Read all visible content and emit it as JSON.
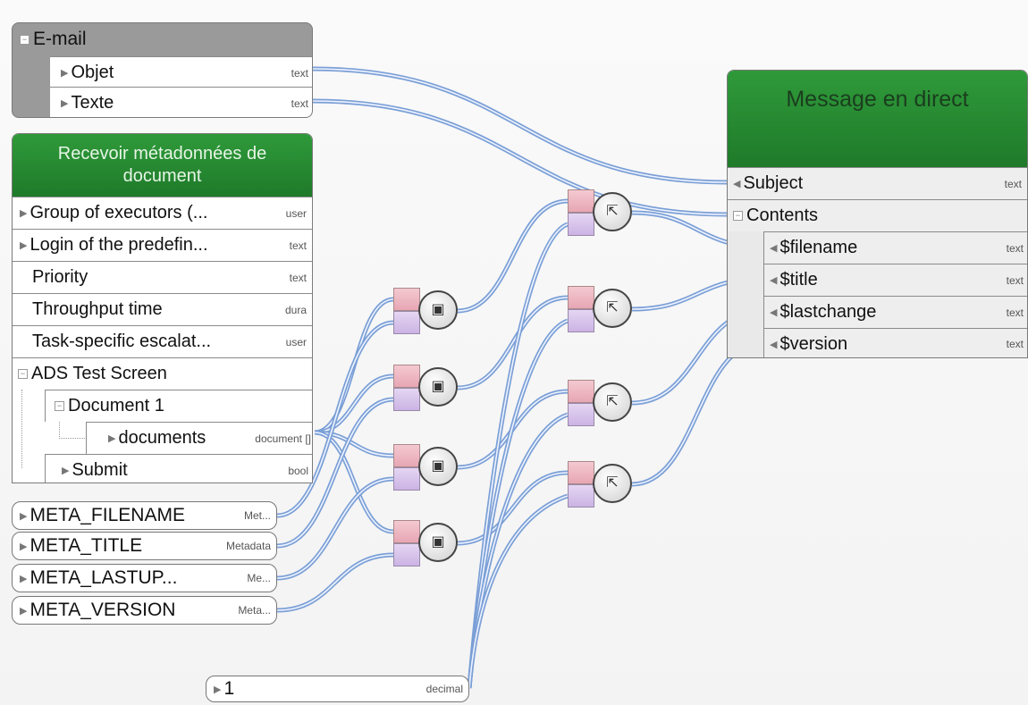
{
  "email_block": {
    "title": "E-mail",
    "rows": [
      {
        "label": "Objet",
        "type": "text"
      },
      {
        "label": "Texte",
        "type": "text"
      }
    ]
  },
  "metadata_block": {
    "title": "Recevoir métadonnées de document",
    "rows": [
      {
        "label": "Group of executors (...",
        "type": "user"
      },
      {
        "label": "Login of the predefin...",
        "type": "text"
      },
      {
        "label": "Priority",
        "type": "text"
      },
      {
        "label": "Throughput time",
        "type": "dura"
      },
      {
        "label": "Task-specific escalat...",
        "type": "user"
      },
      {
        "label": "ADS Test Screen",
        "type": ""
      },
      {
        "label": "Document 1",
        "type": ""
      },
      {
        "label": "documents",
        "type": "document []"
      },
      {
        "label": "Submit",
        "type": "bool"
      }
    ]
  },
  "constants": [
    {
      "label": "META_FILENAME",
      "type": "Met..."
    },
    {
      "label": "META_TITLE",
      "type": "Metadata"
    },
    {
      "label": "META_LASTUP...",
      "type": "Me..."
    },
    {
      "label": "META_VERSION",
      "type": "Meta..."
    }
  ],
  "decimal_const": {
    "label": "1",
    "type": "decimal"
  },
  "message_block": {
    "title": "Message en direct",
    "rows": [
      {
        "label": "Subject",
        "type": "text"
      },
      {
        "label": "Contents",
        "type": ""
      },
      {
        "label": "$filename",
        "type": "text"
      },
      {
        "label": "$title",
        "type": "text"
      },
      {
        "label": "$lastchange",
        "type": "text"
      },
      {
        "label": "$version",
        "type": "text"
      }
    ]
  },
  "icons": {
    "metadata_node": "document-image-icon",
    "select_node": "select-cursor-icon",
    "expand": "collapse-box-icon",
    "arrow": "triangle-right-icon"
  }
}
